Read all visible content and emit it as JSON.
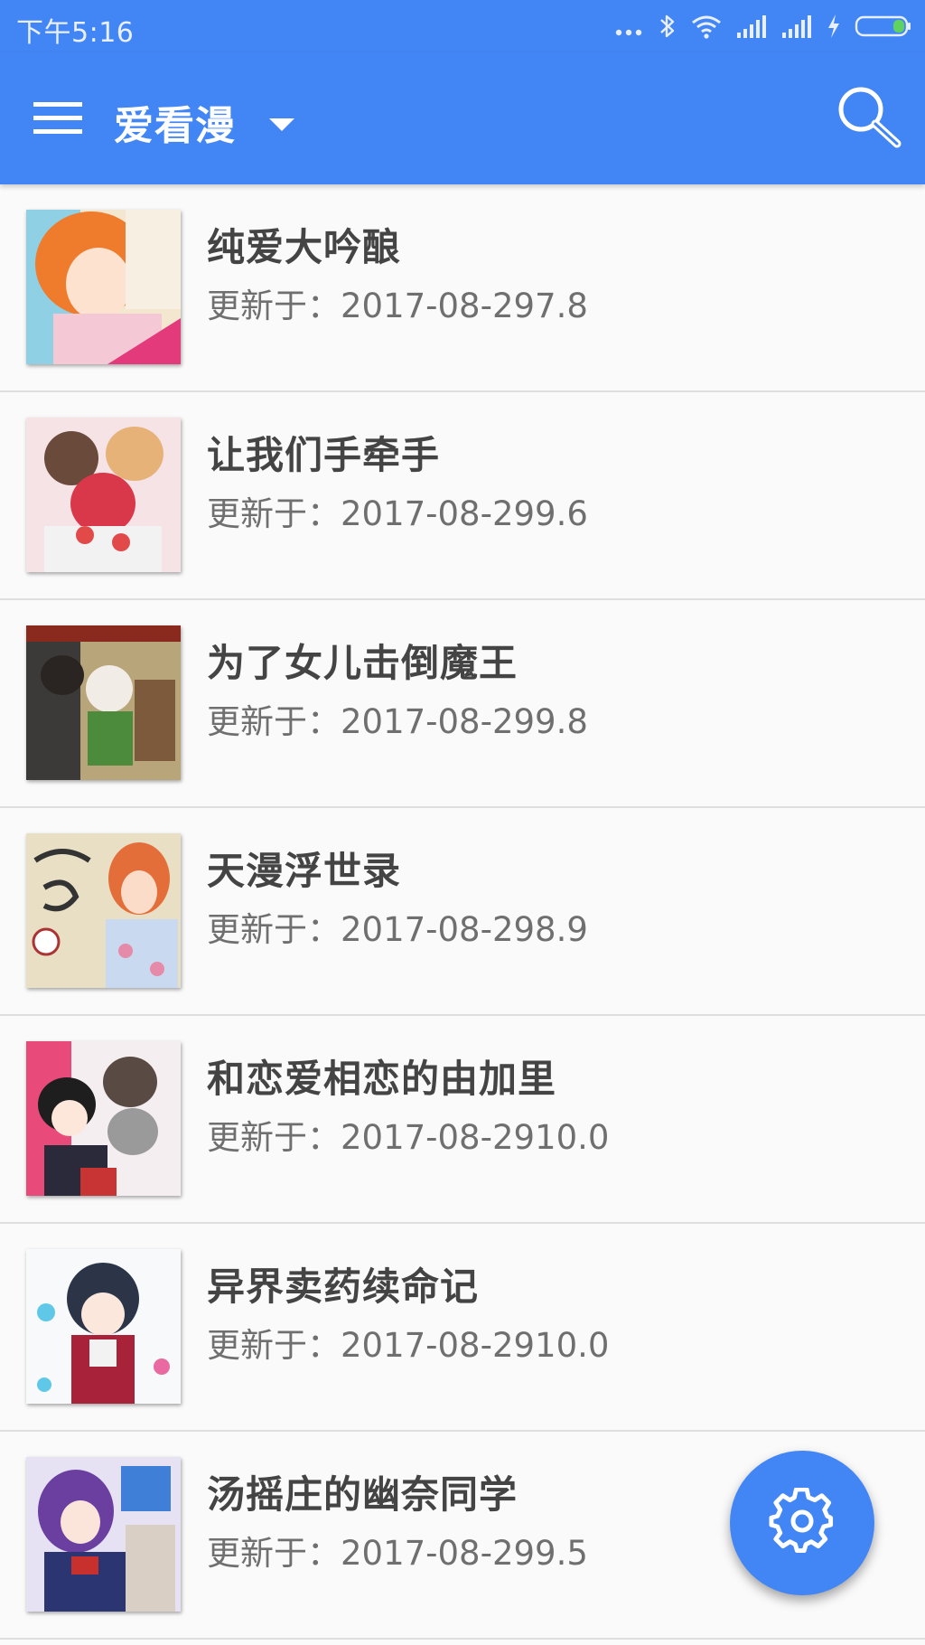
{
  "status_bar": {
    "time": "下午5:16",
    "icons": [
      "more-dots-icon",
      "bluetooth-icon",
      "wifi-icon",
      "signal-icon",
      "signal-icon",
      "charging-icon",
      "battery-icon"
    ]
  },
  "toolbar": {
    "title": "爱看漫",
    "icons": [
      "menu-icon",
      "dropdown-arrow-icon",
      "search-icon"
    ]
  },
  "colors": {
    "primary": "#4285f4",
    "background": "#fafafa",
    "title_text": "#444444",
    "subtitle_text": "#6f6f6f",
    "divider": "#dedede"
  },
  "comics": [
    {
      "title": "纯爱大吟酿",
      "updated": "更新于：2017-08-297.8"
    },
    {
      "title": "让我们手牵手",
      "updated": "更新于：2017-08-299.6"
    },
    {
      "title": "为了女儿击倒魔王",
      "updated": "更新于：2017-08-299.8"
    },
    {
      "title": "天漫浮世录",
      "updated": "更新于：2017-08-298.9"
    },
    {
      "title": "和恋爱相恋的由加里",
      "updated": "更新于：2017-08-2910.0"
    },
    {
      "title": "异界卖药续命记",
      "updated": "更新于：2017-08-2910.0"
    },
    {
      "title": "汤摇庄的幽奈同学",
      "updated": "更新于：2017-08-299.5"
    }
  ],
  "fab": {
    "icon": "gear-icon"
  }
}
